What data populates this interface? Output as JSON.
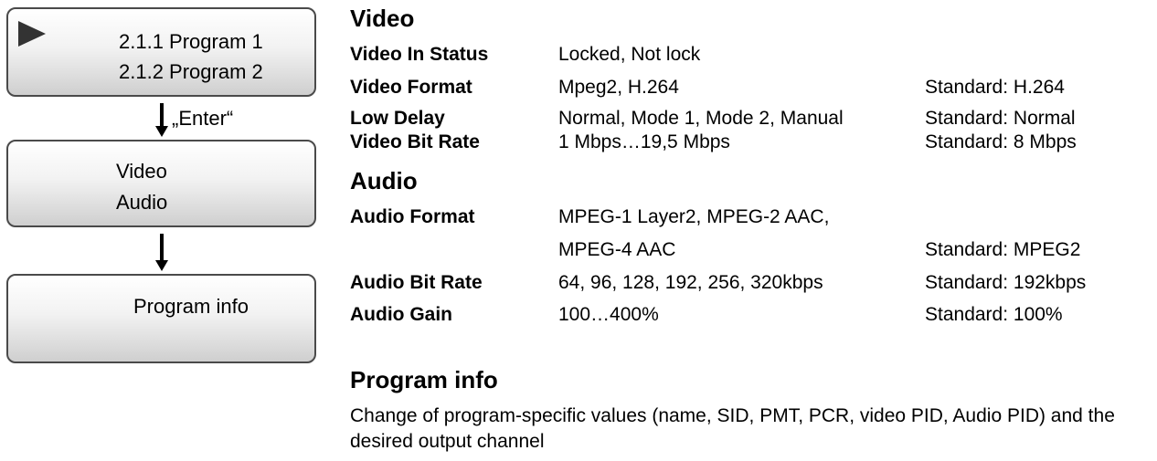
{
  "diagram": {
    "box1": {
      "line1": "2.1.1 Program 1",
      "line2": "2.1.2 Program 2"
    },
    "enter_label": "„Enter“",
    "box2": {
      "line1": "Video",
      "line2": "Audio"
    },
    "box3": {
      "line1": "Program info"
    }
  },
  "video": {
    "title": "Video",
    "rows": [
      {
        "label": "Video In Status",
        "value": "Locked, Not lock",
        "standard": ""
      },
      {
        "label": "Video Format",
        "value": "Mpeg2, H.264",
        "standard": "Standard: H.264"
      },
      {
        "label": "Low Delay",
        "value": "Normal, Mode 1, Mode 2, Manual",
        "standard": "Standard: Normal"
      },
      {
        "label": "Video Bit Rate",
        "value": "1 Mbps…19,5 Mbps",
        "standard": "Standard: 8 Mbps"
      }
    ]
  },
  "audio": {
    "title": "Audio",
    "format": {
      "label": "Audio Format",
      "value_line1": "MPEG-1 Layer2, MPEG-2 AAC,",
      "value_line2": "MPEG-4 AAC",
      "standard": "Standard: MPEG2"
    },
    "rows": [
      {
        "label": "Audio Bit Rate",
        "value": "64, 96, 128, 192, 256, 320kbps",
        "standard": "Standard: 192kbps"
      },
      {
        "label": "Audio Gain",
        "value": "100…400%",
        "standard": "Standard: 100%"
      }
    ]
  },
  "program_info": {
    "title": "Program info",
    "description": "Change of program-specific values (name, SID, PMT, PCR, video PID, Audio PID) and the desired output channel"
  }
}
